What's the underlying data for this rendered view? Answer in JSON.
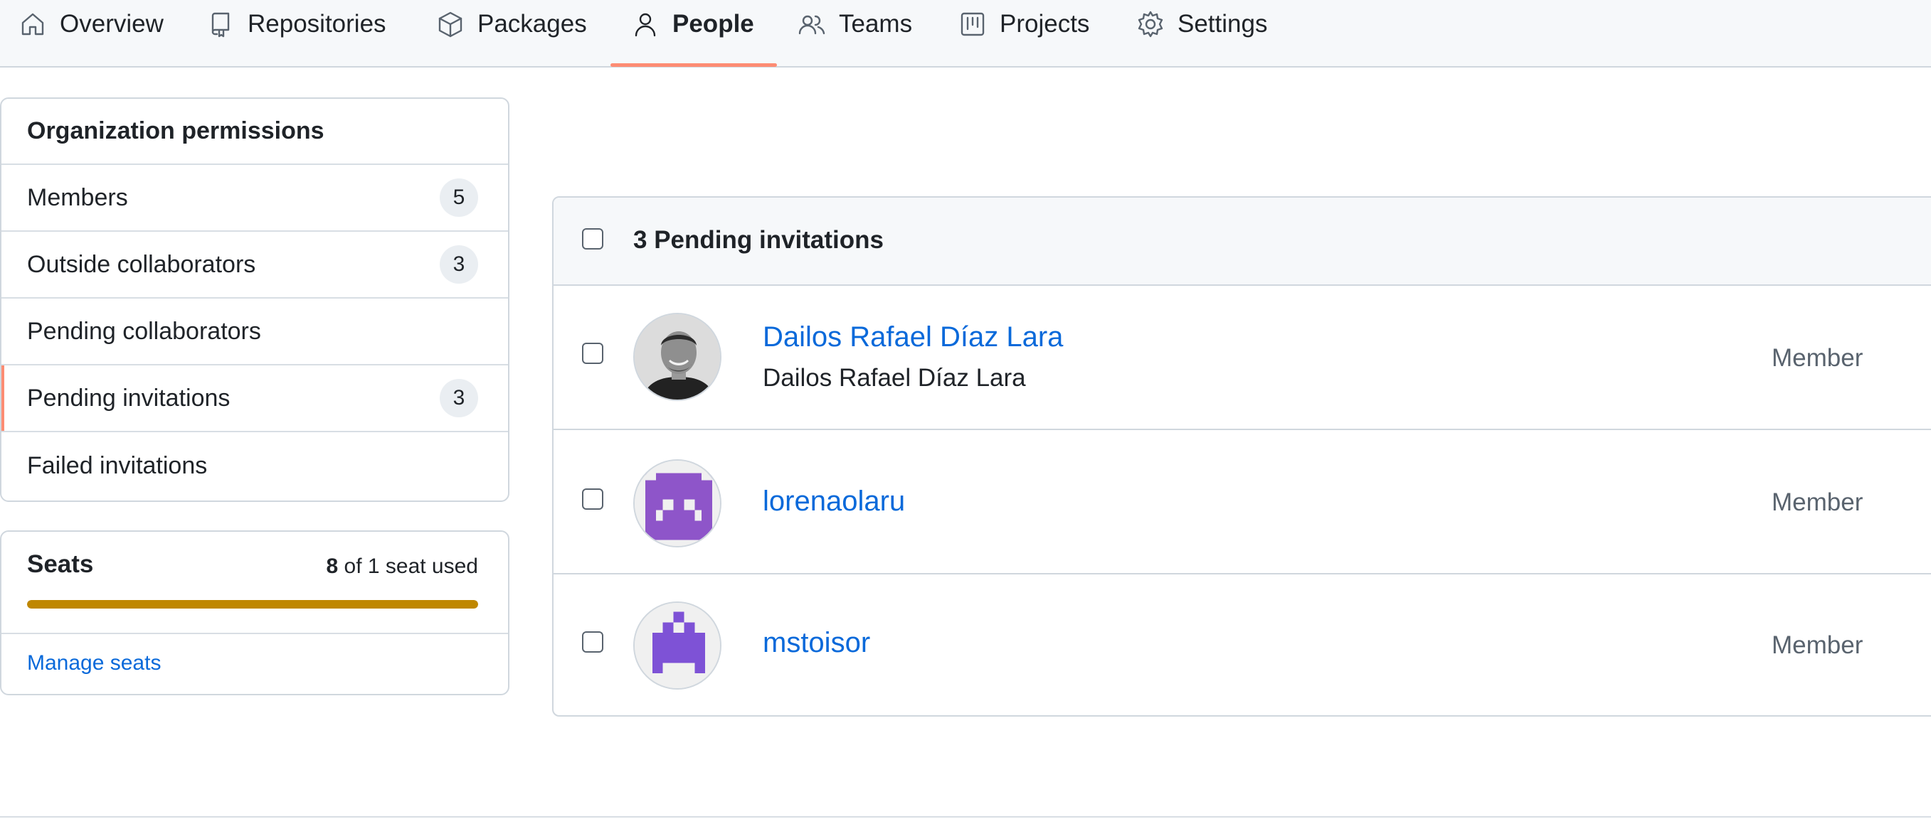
{
  "nav": {
    "items": [
      {
        "label": "Overview",
        "icon": "home-icon"
      },
      {
        "label": "Repositories",
        "icon": "repo-icon"
      },
      {
        "label": "Packages",
        "icon": "package-icon"
      },
      {
        "label": "People",
        "icon": "person-icon",
        "active": true
      },
      {
        "label": "Teams",
        "icon": "people-icon"
      },
      {
        "label": "Projects",
        "icon": "project-icon"
      },
      {
        "label": "Settings",
        "icon": "gear-icon"
      }
    ]
  },
  "menu": {
    "heading": "Organization permissions",
    "items": [
      {
        "label": "Members",
        "count": "5"
      },
      {
        "label": "Outside collaborators",
        "count": "3"
      },
      {
        "label": "Pending collaborators",
        "count": ""
      },
      {
        "label": "Pending invitations",
        "count": "3",
        "selected": true
      },
      {
        "label": "Failed invitations",
        "count": ""
      }
    ]
  },
  "seats": {
    "title": "Seats",
    "used": "8",
    "of_text": " of 1 seat used",
    "usage_fraction": 1.0,
    "manage_label": "Manage seats",
    "bar_color": "#bf8700"
  },
  "invitations": {
    "header": "3 Pending invitations",
    "rows": [
      {
        "login": "Dailos Rafael Díaz Lara",
        "name": "Dailos Rafael Díaz Lara",
        "role": "Member",
        "avatar": "photo-avatar"
      },
      {
        "login": "lorenaolaru",
        "name": "",
        "role": "Member",
        "avatar": "identicon-avatar",
        "avatar_color": "#8e55c9"
      },
      {
        "login": "mstoisor",
        "name": "",
        "role": "Member",
        "avatar": "identicon-avatar",
        "avatar_color": "#7e52d6"
      }
    ]
  },
  "colors": {
    "accent_underline": "#fd8c73",
    "link": "#0969da"
  }
}
